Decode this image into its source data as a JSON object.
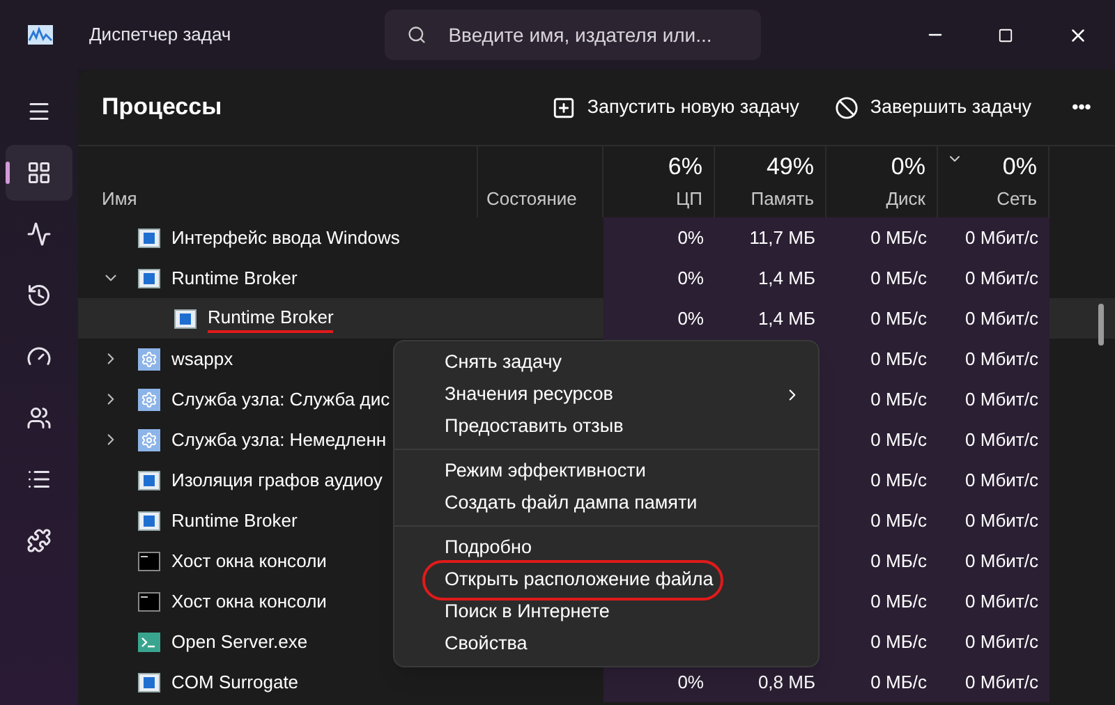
{
  "window": {
    "title": "Диспетчер задач",
    "search": {
      "placeholder": "Введите имя, издателя или..."
    }
  },
  "sidebar": {
    "items": [
      {
        "selected": false
      },
      {
        "selected": true
      },
      {
        "selected": false
      },
      {
        "selected": false
      },
      {
        "selected": false
      },
      {
        "selected": false
      },
      {
        "selected": false
      },
      {
        "selected": false
      }
    ]
  },
  "toolbar": {
    "title": "Процессы",
    "buttons": [
      {
        "label": "Запустить новую задачу"
      },
      {
        "label": "Завершить задачу"
      }
    ],
    "more": "•••"
  },
  "table": {
    "columns": [
      {
        "label": "Имя"
      },
      {
        "label": "Состояние"
      },
      {
        "label": "ЦП",
        "total": "6%"
      },
      {
        "label": "Память",
        "total": "49%"
      },
      {
        "label": "Диск",
        "total": "0%"
      },
      {
        "label": "Сеть",
        "total": "0%",
        "sorted": true
      }
    ],
    "rows": [
      {
        "name": "Интерфейс ввода Windows",
        "kind": "window",
        "selected": false,
        "cpu": "0%",
        "memory": "11,7 МБ",
        "disk": "0 МБ/с",
        "network": "0 Мбит/с"
      },
      {
        "name": "Runtime Broker",
        "kind": "window",
        "expanded": true,
        "selected": false,
        "cpu": "0%",
        "memory": "1,4 МБ",
        "disk": "0 МБ/с",
        "network": "0 Мбит/с",
        "children": [
          {
            "name": "Runtime Broker",
            "kind": "window",
            "selected": true,
            "underlined": true,
            "cpu": "0%",
            "memory": "1,4 МБ",
            "disk": "0 МБ/с",
            "network": "0 Мбит/с"
          }
        ]
      },
      {
        "name": "wsappx",
        "kind": "gear",
        "expanded": false,
        "selected": false,
        "disk": "0 МБ/с",
        "network": "0 Мбит/с"
      },
      {
        "name": "Служба узла: Служба дис",
        "kind": "gear",
        "expanded": false,
        "selected": false,
        "disk": "0 МБ/с",
        "network": "0 Мбит/с"
      },
      {
        "name": "Служба узла: Немедленн",
        "kind": "gear",
        "expanded": false,
        "selected": false,
        "disk": "0 МБ/с",
        "network": "0 Мбит/с"
      },
      {
        "name": "Изоляция графов аудиоу",
        "kind": "window",
        "selected": false,
        "disk": "0 МБ/с",
        "network": "0 Мбит/с"
      },
      {
        "name": "Runtime Broker",
        "kind": "window",
        "selected": false,
        "disk": "0 МБ/с",
        "network": "0 Мбит/с"
      },
      {
        "name": "Хост окна консоли",
        "kind": "console",
        "selected": false,
        "disk": "0 МБ/с",
        "network": "0 Мбит/с"
      },
      {
        "name": "Хост окна консоли",
        "kind": "console",
        "selected": false,
        "disk": "0 МБ/с",
        "network": "0 Мбит/с"
      },
      {
        "name": "Open Server.exe",
        "kind": "terminal",
        "selected": false,
        "disk": "0 МБ/с",
        "network": "0 Мбит/с"
      },
      {
        "name": "COM Surrogate",
        "kind": "window",
        "selected": false,
        "cpu": "0%",
        "memory": "0,8 МБ",
        "disk": "0 МБ/с",
        "network": "0 Мбит/с"
      }
    ]
  },
  "context_menu": {
    "groups": [
      [
        {
          "label": "Снять задачу",
          "submenu": false,
          "circled": false
        },
        {
          "label": "Значения ресурсов",
          "submenu": true,
          "circled": false
        },
        {
          "label": "Предоставить отзыв",
          "submenu": false,
          "circled": false
        }
      ],
      [
        {
          "label": "Режим эффективности",
          "submenu": false,
          "circled": false
        },
        {
          "label": "Создать файл дампа памяти",
          "submenu": false,
          "circled": false
        }
      ],
      [
        {
          "label": "Подробно",
          "submenu": false,
          "circled": false
        },
        {
          "label": "Открыть расположение файла",
          "submenu": false,
          "circled": true
        },
        {
          "label": "Поиск в Интернете",
          "submenu": false,
          "circled": false
        },
        {
          "label": "Свойства",
          "submenu": false,
          "circled": false
        }
      ]
    ]
  }
}
